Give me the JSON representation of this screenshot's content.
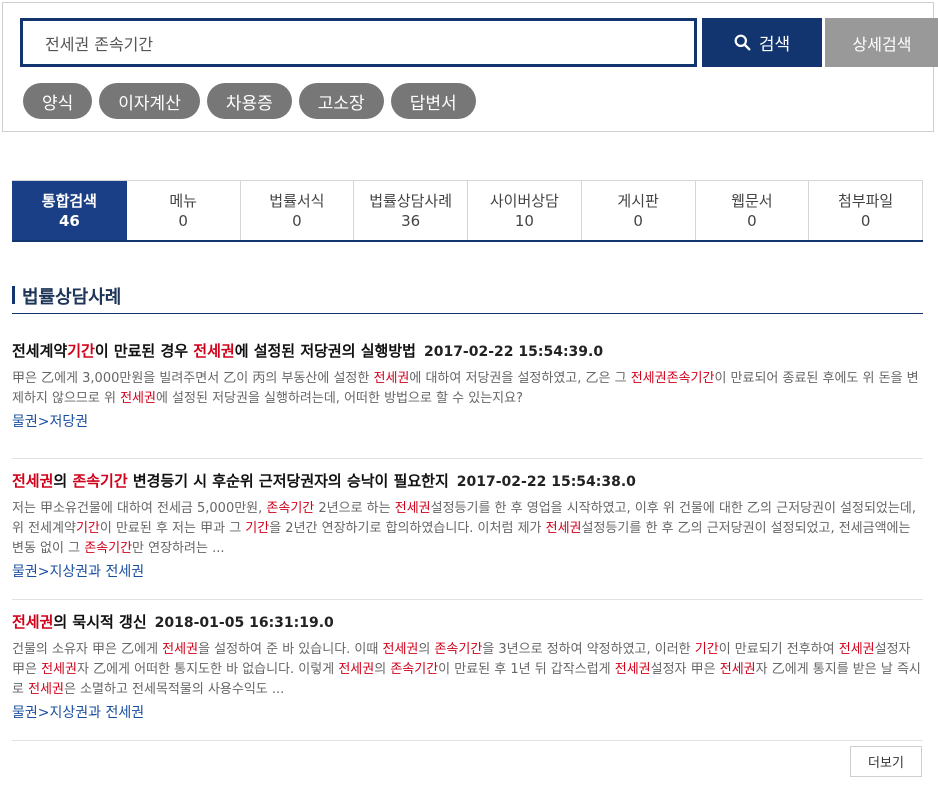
{
  "search": {
    "value": "전세권 존속기간",
    "button_label": "검색",
    "advanced_label": "상세검색"
  },
  "chips": [
    "양식",
    "이자계산",
    "차용증",
    "고소장",
    "답변서"
  ],
  "tabs": [
    {
      "label": "통합검색",
      "count": "46"
    },
    {
      "label": "메뉴",
      "count": "0"
    },
    {
      "label": "법률서식",
      "count": "0"
    },
    {
      "label": "법률상담사례",
      "count": "36"
    },
    {
      "label": "사이버상담",
      "count": "10"
    },
    {
      "label": "게시판",
      "count": "0"
    },
    {
      "label": "웹문서",
      "count": "0"
    },
    {
      "label": "첨부파일",
      "count": "0"
    }
  ],
  "section_title": "법률상담사례",
  "results": [
    {
      "title": [
        {
          "t": "전세계약"
        },
        {
          "t": "기간",
          "hl": true
        },
        {
          "t": "이 만료된 경우 "
        },
        {
          "t": "전세권",
          "hl": true
        },
        {
          "t": "에 설정된 저당권의 실행방법"
        }
      ],
      "date": "2017-02-22 15:54:39.0",
      "body": [
        {
          "t": "甲은 乙에게 3,000만원을 빌려주면서 乙이 丙의 부동산에 설정한 "
        },
        {
          "t": "전세권",
          "hl": true
        },
        {
          "t": "에 대하여 저당권을 설정하였고, 乙은 그 "
        },
        {
          "t": "전세권존속기간",
          "hl": true
        },
        {
          "t": "이 만료되어 종료된 후에도 위 돈을 변제하지 않으므로 위 "
        },
        {
          "t": "전세권",
          "hl": true
        },
        {
          "t": "에 설정된 저당권을 실행하려는데, 어떠한 방법으로 할 수 있는지요?"
        }
      ],
      "category": "물권>저당권"
    },
    {
      "title": [
        {
          "t": "전세권",
          "hl": true
        },
        {
          "t": "의 "
        },
        {
          "t": "존속기간",
          "hl": true
        },
        {
          "t": " 변경등기 시 후순위 근저당권자의 승낙이 필요한지"
        }
      ],
      "date": "2017-02-22 15:54:38.0",
      "body": [
        {
          "t": "저는 甲소유건물에 대하여 전세금 5,000만원, "
        },
        {
          "t": "존속기간",
          "hl": true
        },
        {
          "t": " 2년으로 하는 "
        },
        {
          "t": "전세권",
          "hl": true
        },
        {
          "t": "설정등기를 한 후 영업을 시작하였고, 이후 위 건물에 대한 乙의 근저당권이 설정되었는데, 위 전세계약"
        },
        {
          "t": "기간",
          "hl": true
        },
        {
          "t": "이 만료된 후 저는 甲과 그 "
        },
        {
          "t": "기간",
          "hl": true
        },
        {
          "t": "을 2년간 연장하기로 합의하였습니다. 이처럼 제가 "
        },
        {
          "t": "전세권",
          "hl": true
        },
        {
          "t": "설정등기를 한 후 乙의 근저당권이 설정되었고, 전세금액에는 변동 없이 그 "
        },
        {
          "t": "존속기간",
          "hl": true
        },
        {
          "t": "만 연장하려는 ..."
        }
      ],
      "category": "물권>지상권과 전세권"
    },
    {
      "title": [
        {
          "t": "전세권",
          "hl": true
        },
        {
          "t": "의 묵시적 갱신"
        }
      ],
      "date": "2018-01-05 16:31:19.0",
      "body": [
        {
          "t": "건물의 소유자 甲은 乙에게 "
        },
        {
          "t": "전세권",
          "hl": true
        },
        {
          "t": "을 설정하여 준 바 있습니다. 이때 "
        },
        {
          "t": "전세권",
          "hl": true
        },
        {
          "t": "의 "
        },
        {
          "t": "존속기간",
          "hl": true
        },
        {
          "t": "을 3년으로 정하여 약정하였고, 이러한 "
        },
        {
          "t": "기간",
          "hl": true
        },
        {
          "t": "이 만료되기 전후하여 "
        },
        {
          "t": "전세권",
          "hl": true
        },
        {
          "t": "설정자 甲은 "
        },
        {
          "t": "전세권",
          "hl": true
        },
        {
          "t": "자 乙에게 어떠한 통지도한 바 없습니다. 이렇게 "
        },
        {
          "t": "전세권",
          "hl": true
        },
        {
          "t": "의 "
        },
        {
          "t": "존속기간",
          "hl": true
        },
        {
          "t": "이 만료된 후 1년 뒤 갑작스럽게 "
        },
        {
          "t": "전세권",
          "hl": true
        },
        {
          "t": "설정자 甲은 "
        },
        {
          "t": "전세권",
          "hl": true
        },
        {
          "t": "자 乙에게 통지를 받은 날 즉시로 "
        },
        {
          "t": "전세권",
          "hl": true
        },
        {
          "t": "은 소멸하고 전세목적물의 사용수익도 ..."
        }
      ],
      "category": "물권>지상권과 전세권"
    }
  ],
  "more_label": "더보기"
}
